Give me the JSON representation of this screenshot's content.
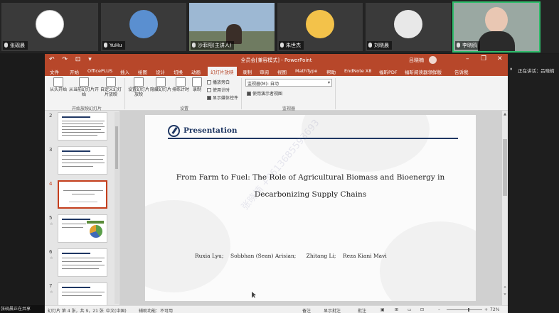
{
  "participants": [
    {
      "name": "张砚晨",
      "avatar_bg": "#ffffff"
    },
    {
      "name": "YuHu",
      "avatar_bg": "#5a8fd0"
    },
    {
      "name": "沙菲阳(主讲人)",
      "avatar_bg": "#7e9bb5"
    },
    {
      "name": "朱世杰",
      "avatar_bg": "#f3c24a"
    },
    {
      "name": "刘晓晨",
      "avatar_bg": "#e8e8e8"
    },
    {
      "name": "李晓鸥",
      "avatar_bg": "#9aa8a2"
    }
  ],
  "window": {
    "title": "全员会[兼容模式] - PowerPoint",
    "user": "吕晓楠",
    "quick_access": "↶ ↷ ⊡ ▾",
    "minimize": "–",
    "restore": "❐",
    "close": "✕"
  },
  "tabs": [
    "文件",
    "开始",
    "OfficePLUS",
    "插入",
    "绘图",
    "设计",
    "切换",
    "动画",
    "幻灯片放映",
    "录制",
    "审阅",
    "视图",
    "MathType",
    "帮助",
    "EndNote X8",
    "福昕PDF",
    "福昕阅读器领鲜版",
    "告诉我"
  ],
  "active_tab": "幻灯片放映",
  "ribbon": {
    "buttons": [
      "从头开始",
      "从当前幻灯片开始",
      "自定义幻灯片放映",
      "设置幻灯片放映",
      "隐藏幻灯片",
      "排练计时",
      "录制"
    ],
    "checkboxes": [
      "播放旁白",
      "使用计时",
      "显示媒体控件"
    ],
    "monitor_label": "监视器(M):",
    "monitor_value": "自动",
    "presenter_view": "使用演示者视图",
    "groups": [
      "开始放映幻灯片",
      "设置",
      "监视器"
    ]
  },
  "thumbnails": [
    {
      "num": "2",
      "star": ""
    },
    {
      "num": "3",
      "star": ""
    },
    {
      "num": "4",
      "star": ""
    },
    {
      "num": "5",
      "star": "☆"
    },
    {
      "num": "6",
      "star": "☆"
    },
    {
      "num": "7",
      "star": "☆"
    }
  ],
  "selected_slide": 4,
  "slide": {
    "header": "Presentation",
    "title_line1": "From Farm to Fuel: The Role of Agricultural Biomass and Bioenergy in",
    "title_line2": "Decarbonizing Supply Chains",
    "authors": "Ruxia Lyu;    Sobbhan (Sean) Arisian;      Zhitang Li;    Reza Kiani Mavi",
    "watermark": "张晓楠 +8613685593693"
  },
  "status": {
    "slide_info": "幻灯片 第 4 张，共 9，21 张",
    "language": "中文(中国)",
    "accessibility": "辅助功能：不可用",
    "notes": "备注",
    "comments": "显示批注",
    "display_settings": "批注",
    "zoom": "72%"
  },
  "meeting": {
    "right_label": "正在讲话：",
    "right_name": "吕晓楠",
    "left_label": "张砚晨正在共享"
  },
  "colors": {
    "ppt_accent": "#b7472a",
    "slide_title": "#1f3763",
    "highlight": "#2fbd6b"
  }
}
